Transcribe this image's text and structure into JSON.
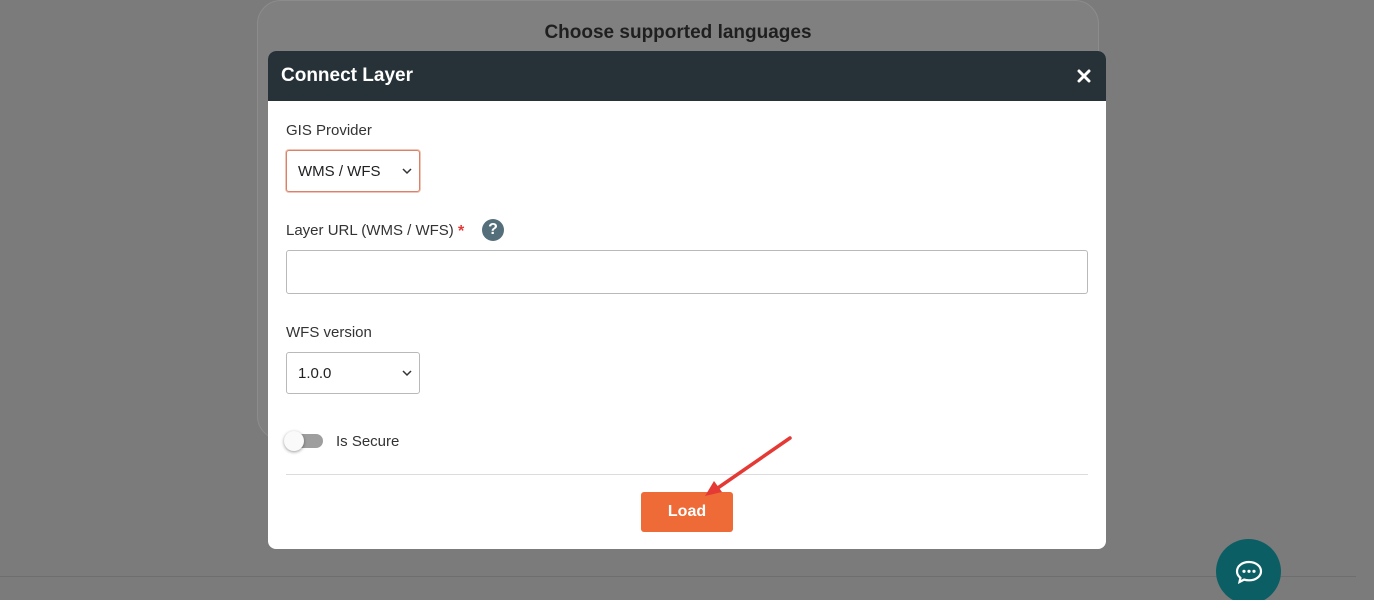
{
  "background": {
    "title": "Choose supported languages"
  },
  "modal": {
    "title": "Connect Layer",
    "gis_provider": {
      "label": "GIS Provider",
      "selected": "WMS / WFS"
    },
    "layer_url": {
      "label": "Layer URL (WMS / WFS)",
      "required_mark": "*",
      "help_glyph": "?",
      "value": ""
    },
    "wfs_version": {
      "label": "WFS version",
      "selected": "1.0.0"
    },
    "is_secure": {
      "label": "Is Secure",
      "checked": false
    },
    "load_label": "Load"
  },
  "colors": {
    "header": "#263238",
    "accent": "#ee6a37",
    "chat_fab": "#0b5f64",
    "annotation_arrow": "#e53935"
  },
  "icons": {
    "close": "close-icon",
    "help": "question-circle-icon",
    "chevron": "chevron-down-icon",
    "chat": "chat-bubble-icon"
  }
}
